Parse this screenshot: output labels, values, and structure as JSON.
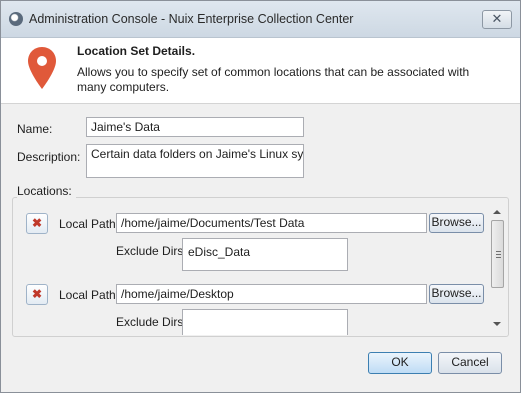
{
  "window": {
    "title": "Administration Console - Nuix Enterprise Collection Center",
    "close_label": "✕"
  },
  "header": {
    "title": "Location Set Details.",
    "description": "Allows you to specify set of common locations that can be associated with many computers.",
    "icon": "map-pin-icon",
    "icon_color": "#e0593a"
  },
  "form": {
    "name_label": "Name:",
    "name_value": "Jaime's Data",
    "description_label": "Description:",
    "description_value": "Certain data folders on Jaime's Linux system"
  },
  "locations": {
    "label": "Locations:",
    "items": [
      {
        "remove_label": "✖",
        "local_path_label": "Local Path:",
        "local_path_value": "/home/jaime/Documents/Test Data",
        "browse_label": "Browse...",
        "exclude_label": "Exclude Dirs:",
        "exclude_value": "eDisc_Data"
      },
      {
        "remove_label": "✖",
        "local_path_label": "Local Path:",
        "local_path_value": "/home/jaime/Desktop",
        "browse_label": "Browse...",
        "exclude_label": "Exclude Dirs:",
        "exclude_value": ""
      }
    ]
  },
  "buttons": {
    "ok": "OK",
    "cancel": "Cancel"
  }
}
